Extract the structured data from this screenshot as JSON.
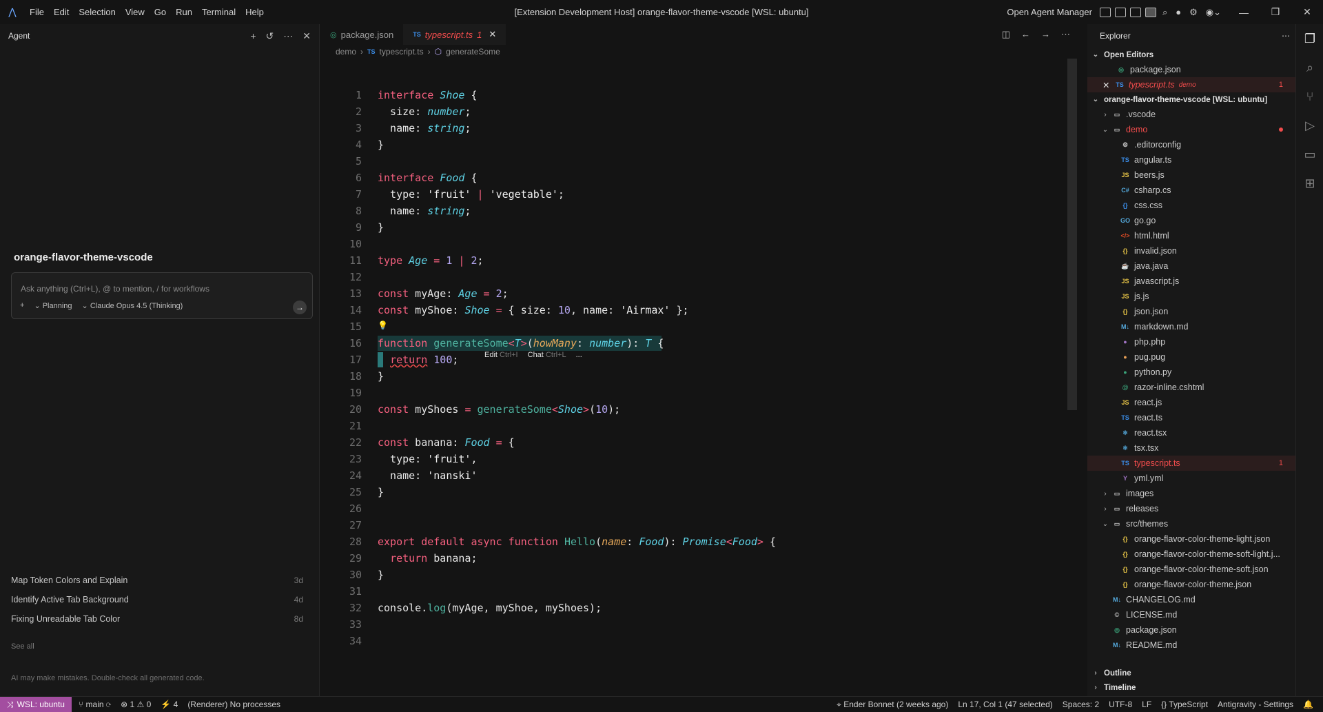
{
  "window": {
    "title": "[Extension Development Host] orange-flavor-theme-vscode [WSL: ubuntu]",
    "menu": [
      "File",
      "Edit",
      "Selection",
      "View",
      "Go",
      "Run",
      "Terminal",
      "Help"
    ],
    "agent_manager": "Open Agent Manager"
  },
  "agent": {
    "header": "Agent",
    "project_title": "orange-flavor-theme-vscode",
    "input_placeholder": "Ask anything (Ctrl+L), @ to mention, / for workflows",
    "plus": "+",
    "mode": "Planning",
    "model": "Claude Opus 4.5 (Thinking)",
    "history": [
      {
        "title": "Map Token Colors and Explain",
        "age": "3d"
      },
      {
        "title": "Identify Active Tab Background",
        "age": "4d"
      },
      {
        "title": "Fixing Unreadable Tab Color",
        "age": "8d"
      }
    ],
    "see_all": "See all",
    "disclaimer": "AI may make mistakes. Double-check all generated code."
  },
  "editor": {
    "tabs": [
      {
        "label": "package.json",
        "icon": "json-icon"
      },
      {
        "label": "typescript.ts",
        "badge": "1",
        "icon": "ts-icon",
        "active": true
      }
    ],
    "breadcrumb": [
      "demo",
      "typescript.ts",
      "generateSome"
    ],
    "inline_actions": {
      "edit": "Edit",
      "edit_key": "Ctrl+I",
      "chat": "Chat",
      "chat_key": "Ctrl+L",
      "more": "..."
    },
    "line_numbers": [
      "1",
      "2",
      "3",
      "4",
      "5",
      "6",
      "7",
      "8",
      "9",
      "10",
      "11",
      "12",
      "13",
      "14",
      "15",
      "16",
      "17",
      "18",
      "19",
      "20",
      "21",
      "22",
      "23",
      "24",
      "25",
      "26",
      "27",
      "28",
      "29",
      "30",
      "31",
      "32",
      "33",
      "34"
    ]
  },
  "explorer": {
    "header": "Explorer",
    "open_editors_title": "Open Editors",
    "open_editors": [
      {
        "name": "package.json"
      },
      {
        "name": "typescript.ts",
        "folder": "demo",
        "count": "1"
      }
    ],
    "workspace_title": "orange-flavor-theme-vscode [WSL: ubuntu]",
    "tree": [
      {
        "name": ".vscode",
        "type": "folder"
      },
      {
        "name": "demo",
        "type": "folder-open"
      },
      {
        "name": ".editorconfig",
        "icon": "⚙",
        "color": "#cccccc"
      },
      {
        "name": "angular.ts",
        "icon": "TS",
        "color": "#3b8eea"
      },
      {
        "name": "beers.js",
        "icon": "JS",
        "color": "#e8c547"
      },
      {
        "name": "csharp.cs",
        "icon": "C#",
        "color": "#55aadd"
      },
      {
        "name": "css.css",
        "icon": "{}",
        "color": "#3b8eea"
      },
      {
        "name": "go.go",
        "icon": "GO",
        "color": "#55aadd"
      },
      {
        "name": "html.html",
        "icon": "</>",
        "color": "#e44d26"
      },
      {
        "name": "invalid.json",
        "icon": "{}",
        "color": "#e8c547"
      },
      {
        "name": "java.java",
        "icon": "☕",
        "color": "#e44d26"
      },
      {
        "name": "javascript.js",
        "icon": "JS",
        "color": "#e8c547"
      },
      {
        "name": "js.js",
        "icon": "JS",
        "color": "#e8c547"
      },
      {
        "name": "json.json",
        "icon": "{}",
        "color": "#e8c547"
      },
      {
        "name": "markdown.md",
        "icon": "M↓",
        "color": "#55aadd"
      },
      {
        "name": "php.php",
        "icon": "●",
        "color": "#a074c4"
      },
      {
        "name": "pug.pug",
        "icon": "●",
        "color": "#e8a057"
      },
      {
        "name": "python.py",
        "icon": "●",
        "color": "#3aa37a"
      },
      {
        "name": "razor-inline.cshtml",
        "icon": "@",
        "color": "#3aa37a"
      },
      {
        "name": "react.js",
        "icon": "JS",
        "color": "#e8c547"
      },
      {
        "name": "react.ts",
        "icon": "TS",
        "color": "#3b8eea"
      },
      {
        "name": "react.tsx",
        "icon": "⚛",
        "color": "#55aadd"
      },
      {
        "name": "tsx.tsx",
        "icon": "⚛",
        "color": "#55aadd"
      },
      {
        "name": "typescript.ts",
        "icon": "TS",
        "color": "#3b8eea",
        "count": "1"
      },
      {
        "name": "yml.yml",
        "icon": "Y",
        "color": "#a074c4"
      },
      {
        "name": "images",
        "type": "folder"
      },
      {
        "name": "releases",
        "type": "folder"
      },
      {
        "name": "src/themes",
        "type": "folder-open"
      },
      {
        "name": "orange-flavor-color-theme-light.json",
        "icon": "{}",
        "color": "#e8c547"
      },
      {
        "name": "orange-flavor-color-theme-soft-light.j...",
        "icon": "{}",
        "color": "#e8c547"
      },
      {
        "name": "orange-flavor-color-theme-soft.json",
        "icon": "{}",
        "color": "#e8c547"
      },
      {
        "name": "orange-flavor-color-theme.json",
        "icon": "{}",
        "color": "#e8c547"
      },
      {
        "name": "CHANGELOG.md",
        "icon": "M↓",
        "color": "#55aadd"
      },
      {
        "name": "LICENSE.md",
        "icon": "©",
        "color": "#cccccc"
      },
      {
        "name": "package.json",
        "icon": "◎",
        "color": "#3aa37a"
      },
      {
        "name": "README.md",
        "icon": "M↓",
        "color": "#55aadd"
      }
    ],
    "outline": "Outline",
    "timeline": "Timeline"
  },
  "status": {
    "remote": "WSL: ubuntu",
    "branch": "main",
    "errors": "1",
    "warnings": "0",
    "ports": "4",
    "renderer": "(Renderer) No processes",
    "blame": "Ender Bonnet (2 weeks ago)",
    "position": "Ln 17, Col 1 (47 selected)",
    "spaces": "Spaces: 2",
    "encoding": "UTF-8",
    "eol": "LF",
    "language": "TypeScript",
    "settings": "Antigravity - Settings"
  },
  "colors": {
    "accent": "#a34ea0",
    "error": "#f14c4c"
  }
}
